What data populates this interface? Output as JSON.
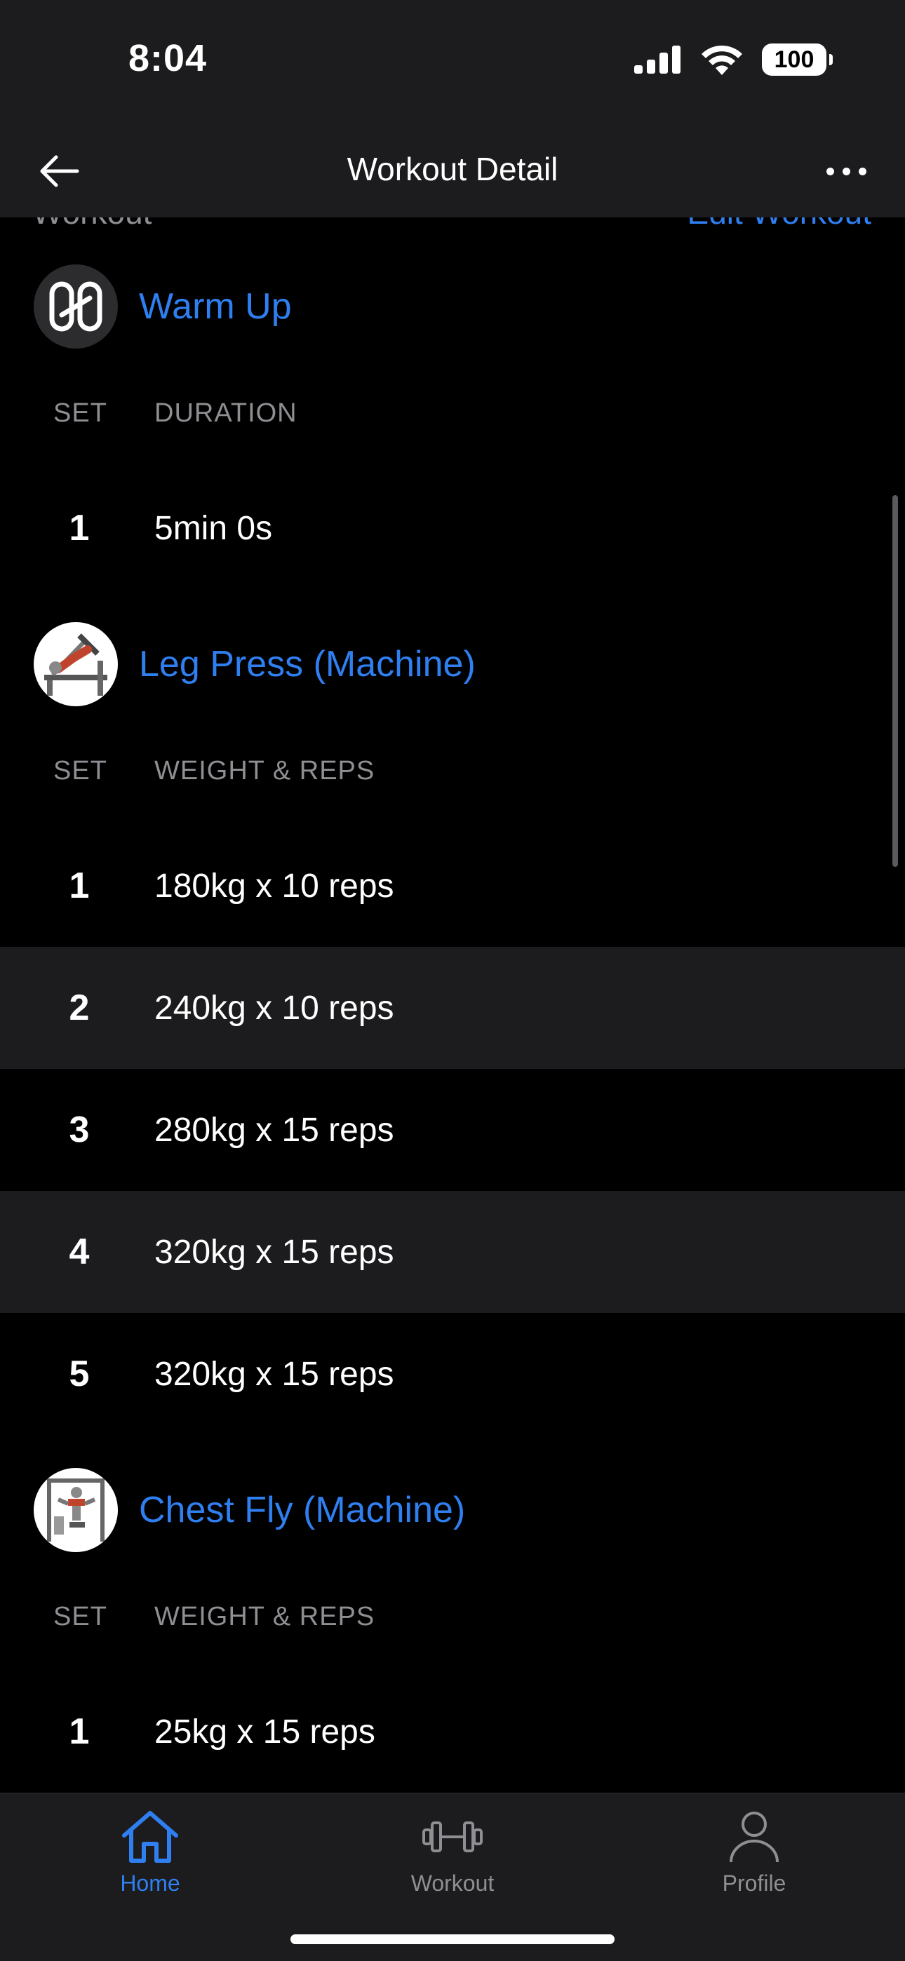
{
  "status_bar": {
    "time": "8:04",
    "battery": "100"
  },
  "nav": {
    "title": "Workout Detail"
  },
  "peek": {
    "left": "Workout",
    "right": "Edit Workout"
  },
  "exercises": [
    {
      "name": "Warm Up",
      "icon": "stopwatch-icon",
      "columns": [
        "SET",
        "DURATION"
      ],
      "sets": [
        {
          "set": "1",
          "value": "5min 0s"
        }
      ]
    },
    {
      "name": "Leg Press (Machine)",
      "icon": "leg-press-thumbnail",
      "columns": [
        "SET",
        "WEIGHT & REPS"
      ],
      "sets": [
        {
          "set": "1",
          "value": "180kg x 10 reps"
        },
        {
          "set": "2",
          "value": "240kg x 10 reps"
        },
        {
          "set": "3",
          "value": "280kg x 15 reps"
        },
        {
          "set": "4",
          "value": "320kg x 15 reps"
        },
        {
          "set": "5",
          "value": "320kg x 15 reps"
        }
      ]
    },
    {
      "name": "Chest Fly (Machine)",
      "icon": "chest-fly-thumbnail",
      "columns": [
        "SET",
        "WEIGHT & REPS"
      ],
      "sets": [
        {
          "set": "1",
          "value": "25kg x 15 reps"
        }
      ]
    }
  ],
  "tabs": [
    {
      "label": "Home",
      "icon": "home-icon",
      "active": true
    },
    {
      "label": "Workout",
      "icon": "dumbbell-icon",
      "active": false
    },
    {
      "label": "Profile",
      "icon": "profile-icon",
      "active": false
    }
  ],
  "colors": {
    "accent": "#2f7ff0",
    "background": "#000000",
    "surface": "#1c1c1e",
    "muted": "#8e8e93"
  }
}
